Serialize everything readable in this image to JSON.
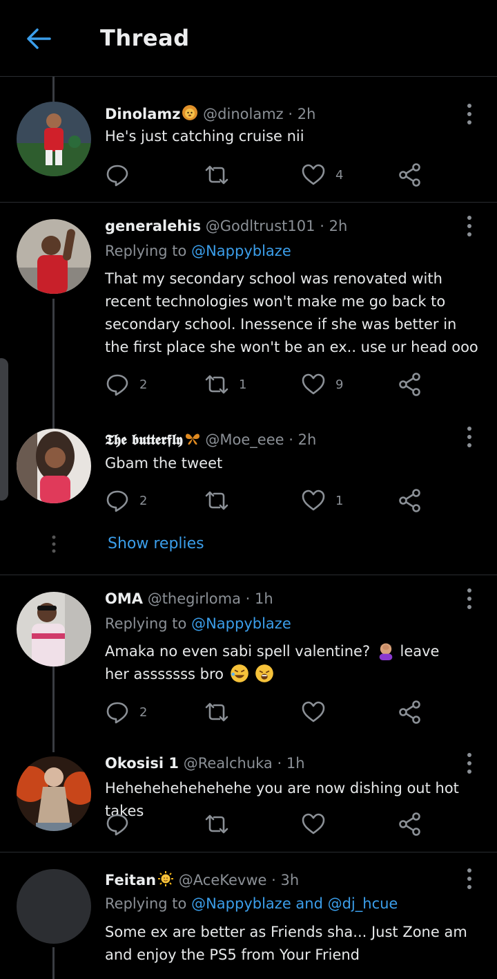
{
  "header": {
    "title": "Thread"
  },
  "tweets": [
    {
      "name": "Dinolamz",
      "handle": "@dinolamz",
      "time": "2h",
      "replying_to": "",
      "text": "He's just catching cruise nii",
      "reply_count": "",
      "retweet_count": "",
      "like_count": "4"
    },
    {
      "name": "generalehis",
      "handle": "@Godltrust101",
      "time": "2h",
      "replying_label": "Replying to",
      "replying_to": "@Nappyblaze",
      "text": "That my secondary school was renovated with recent technologies won't make me go back to secondary school. Inessence if she was better in the first place she won't be an ex.. use ur head ooo",
      "reply_count": "2",
      "retweet_count": "1",
      "like_count": "9"
    },
    {
      "name": "𝕿𝖍𝖊 𝖇𝖚𝖙𝖙𝖊𝖗𝖋𝖑𝖞",
      "handle": "@Moe_eee",
      "time": "2h",
      "replying_to": "",
      "text": "Gbam the tweet",
      "reply_count": "2",
      "retweet_count": "",
      "like_count": "1",
      "show_replies": "Show replies"
    },
    {
      "name": "OMA",
      "handle": "@thegirloma",
      "time": "1h",
      "replying_label": "Replying to",
      "replying_to": "@Nappyblaze",
      "text": "Amaka no even sabi spell valentine?",
      "text_after": "leave her asssssss bro",
      "reply_count": "2",
      "retweet_count": "",
      "like_count": ""
    },
    {
      "name": "Okosisi 1",
      "handle": "@Realchuka",
      "time": "1h",
      "replying_to": "",
      "text": "Hehehehehehehehe you are now dishing out hot takes",
      "reply_count": "",
      "retweet_count": "",
      "like_count": ""
    },
    {
      "name": "Feitan",
      "handle": "@AceKevwe",
      "time": "3h",
      "replying_label": "Replying to",
      "replying_to": "@Nappyblaze and @dj_hcue",
      "text": "Some ex are better as Friends sha... Just Zone am and enjoy the PS5 from Your Friend"
    }
  ],
  "colors": {
    "accent": "#3b9eea",
    "background": "#000000",
    "muted": "#8b9096",
    "divider": "#2a2d31"
  },
  "icons": [
    "back-arrow-icon",
    "more-vertical-icon",
    "reply-icon",
    "retweet-icon",
    "like-icon",
    "share-icon",
    "lion-emoji-icon",
    "butterfly-emoji-icon",
    "facepalm-emoji-icon",
    "rofl-emoji-icon",
    "weary-emoji-icon",
    "sun-emoji-icon"
  ]
}
